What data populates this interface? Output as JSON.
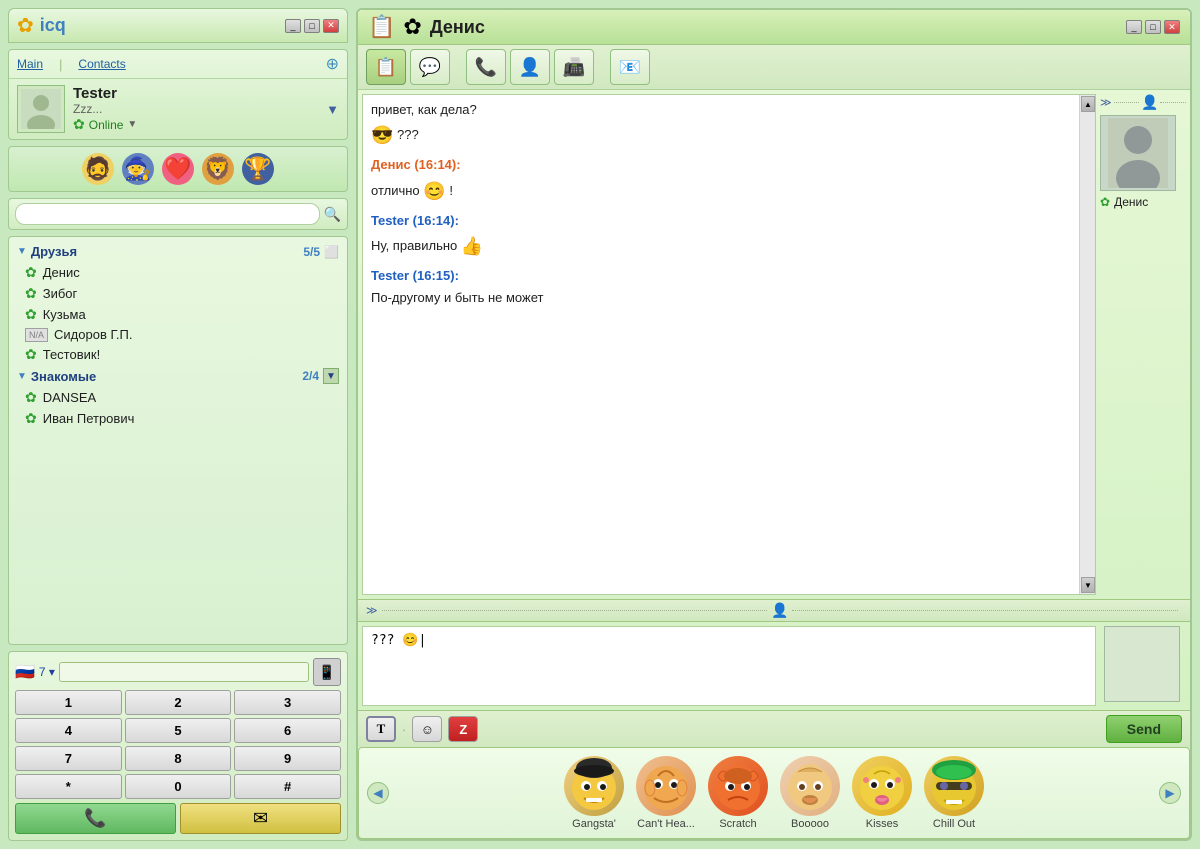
{
  "app": {
    "title": "ICQ"
  },
  "left_panel": {
    "nav": {
      "main": "Main",
      "contacts": "Contacts"
    },
    "user": {
      "name": "Tester",
      "status": "Zzz...",
      "online": "Online"
    },
    "search": {
      "placeholder": ""
    },
    "groups": [
      {
        "name": "Друзья",
        "count": "5/5",
        "contacts": [
          {
            "name": "Денис",
            "type": "flower"
          },
          {
            "name": "Зибог",
            "type": "flower"
          },
          {
            "name": "Кузьма",
            "type": "flower"
          },
          {
            "name": "Сидоров Г.П.",
            "type": "na"
          },
          {
            "name": "Тестовик!",
            "type": "flower"
          }
        ]
      },
      {
        "name": "Знакомые",
        "count": "2/4",
        "contacts": [
          {
            "name": "DANSEA",
            "type": "flower"
          },
          {
            "name": "Иван Петрович",
            "type": "flower"
          }
        ]
      }
    ],
    "dialer": {
      "country_code": "7",
      "keys": [
        "1",
        "2",
        "3",
        "4",
        "5",
        "6",
        "7",
        "8",
        "9",
        "*",
        "0",
        "#"
      ]
    }
  },
  "chat": {
    "title": "Денис",
    "messages": [
      {
        "type": "text",
        "text": "привет, как дела?"
      },
      {
        "type": "emoji_text",
        "emoji": "😎",
        "text": "???"
      },
      {
        "type": "sender",
        "sender": "Денис (16:14):"
      },
      {
        "type": "emoji_text",
        "emoji": "😊",
        "text": "отлично",
        "suffix": "!"
      },
      {
        "type": "sender",
        "sender": "Tester (16:14):"
      },
      {
        "type": "emoji_text",
        "text": "Ну, правильно",
        "emoji": "👍"
      },
      {
        "type": "sender",
        "sender": "Tester (16:15):"
      },
      {
        "type": "text",
        "text": "По-другому и быть не может"
      }
    ],
    "input": {
      "text": "??? 😊|"
    },
    "contact_name": "Денис",
    "toolbar_buttons": [
      "📋",
      "💬",
      "📞",
      "👤",
      "📠",
      "📧"
    ],
    "format_buttons": [
      {
        "label": "T",
        "type": "text"
      },
      {
        "label": "☺",
        "type": "emoji"
      },
      {
        "label": "Z",
        "type": "zzz"
      }
    ],
    "send_label": "Send",
    "emoticons": [
      {
        "label": "Gangsta'",
        "emoji": "🤠"
      },
      {
        "label": "Can't Hea...",
        "emoji": "😝"
      },
      {
        "label": "Scratch",
        "emoji": "🐱"
      },
      {
        "label": "Booooo",
        "emoji": "🐰"
      },
      {
        "label": "Kisses",
        "emoji": "😘"
      },
      {
        "label": "Chill Out",
        "emoji": "😎"
      }
    ]
  }
}
